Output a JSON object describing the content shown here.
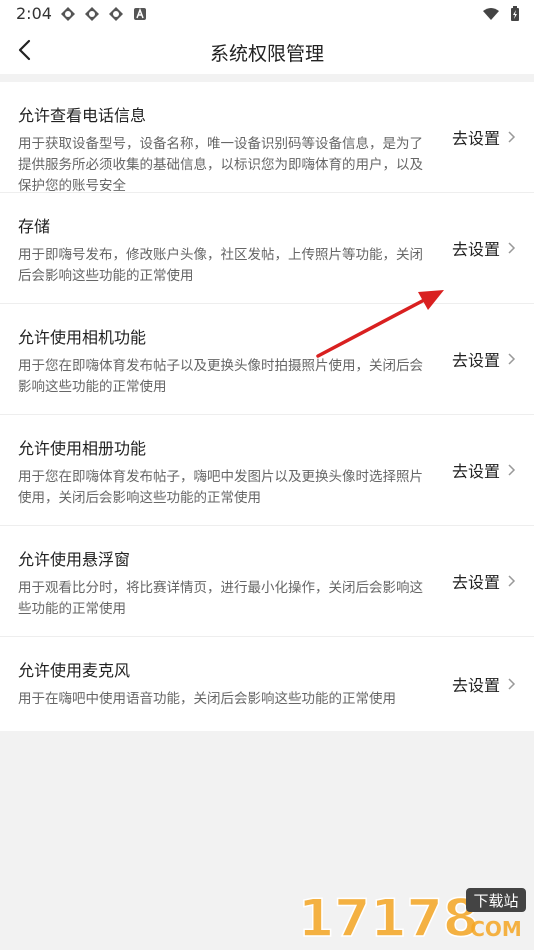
{
  "status_bar": {
    "time": "2:04"
  },
  "header": {
    "title": "系统权限管理",
    "back_icon": "chevron-left-icon"
  },
  "permissions": [
    {
      "title": "允许查看电话信息",
      "desc": "用于获取设备型号，设备名称，唯一设备识别码等设备信息，是为了提供服务所必须收集的基础信息，以标识您为即嗨体育的用户，以及保护您的账号安全",
      "action": "去设置"
    },
    {
      "title": "存储",
      "desc": "用于即嗨号发布，修改账户头像，社区发帖，上传照片等功能，关闭后会影响这些功能的正常使用",
      "action": "去设置"
    },
    {
      "title": "允许使用相机功能",
      "desc": "用于您在即嗨体育发布帖子以及更换头像时拍摄照片使用，关闭后会影响这些功能的正常使用",
      "action": "去设置"
    },
    {
      "title": "允许使用相册功能",
      "desc": "用于您在即嗨体育发布帖子，嗨吧中发图片以及更换头像时选择照片使用，关闭后会影响这些功能的正常使用",
      "action": "去设置"
    },
    {
      "title": "允许使用悬浮窗",
      "desc": "用于观看比分时，将比赛详情页，进行最小化操作，关闭后会影响这些功能的正常使用",
      "action": "去设置"
    },
    {
      "title": "允许使用麦克风",
      "desc": "用于在嗨吧中使用语音功能，关闭后会影响这些功能的正常使用",
      "action": "去设置"
    }
  ],
  "watermark": {
    "number": "17178",
    "badge": "下载站",
    "domain": "COM"
  },
  "colors": {
    "accent_arrow": "#d92020",
    "watermark_orange": "#f5a623"
  }
}
